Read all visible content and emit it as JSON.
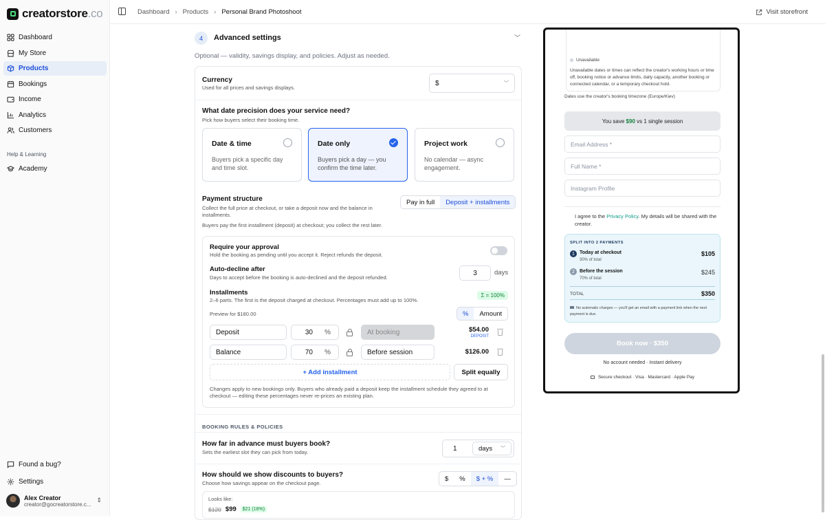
{
  "brand": {
    "name": "creatorstore",
    "suffix": ".co"
  },
  "nav": [
    {
      "label": "Dashboard",
      "icon": "grid-icon"
    },
    {
      "label": "My Store",
      "icon": "store-icon"
    },
    {
      "label": "Products",
      "icon": "box-icon",
      "active": true
    },
    {
      "label": "Bookings",
      "icon": "calendar-icon"
    },
    {
      "label": "Income",
      "icon": "wallet-icon"
    },
    {
      "label": "Analytics",
      "icon": "chart-icon"
    },
    {
      "label": "Customers",
      "icon": "users-icon"
    }
  ],
  "help_section": "Help & Learning",
  "academy": "Academy",
  "bug": "Found a bug?",
  "settings": "Settings",
  "user": {
    "name": "Alex Creator",
    "email": "creator@gocreatorstore.c..."
  },
  "breadcrumb": [
    "Dashboard",
    "Products",
    "Personal Brand Photoshoot"
  ],
  "visit": "Visit storefront",
  "step": {
    "num": "4",
    "title": "Advanced settings",
    "desc": "Optional — validity, savings display, and policies. Adjust as needed."
  },
  "currency": {
    "label": "Currency",
    "sub": "Used for all prices and savings displays.",
    "value": "$"
  },
  "precision": {
    "label": "What date precision does your service need?",
    "sub": "Pick how buyers select their booking time.",
    "options": [
      {
        "title": "Date & time",
        "desc": "Buyers pick a specific day and time slot."
      },
      {
        "title": "Date only",
        "desc": "Buyers pick a day — you confirm the time later.",
        "selected": true
      },
      {
        "title": "Project work",
        "desc": "No calendar — async engagement."
      }
    ]
  },
  "payment": {
    "label": "Payment structure",
    "sub": "Collect the full price at checkout, or take a deposit now and the balance in installments.",
    "note": "Buyers pay the first installment (deposit) at checkout; you collect the rest later.",
    "toggle": [
      "Pay in full",
      "Deposit + installments"
    ],
    "selected": "Deposit + installments"
  },
  "approval": {
    "label": "Require your approval",
    "sub": "Hold the booking as pending until you accept it. Reject refunds the deposit.",
    "enabled": false
  },
  "autodecline": {
    "label": "Auto-decline after",
    "sub": "Days to accept before the booking is auto-declined and the deposit refunded.",
    "value": "3",
    "unit": "days"
  },
  "installments": {
    "label": "Installments",
    "sub": "2–6 parts. The first is the deposit charged at checkout. Percentages must add up to 100%.",
    "badge": "Σ = 100%",
    "preview": "Preview for $180.00",
    "mode": [
      "%",
      "Amount"
    ],
    "rows": [
      {
        "name": "Deposit",
        "pct": "30",
        "sym": "%",
        "when": "At booking",
        "amount": "$54.00",
        "tag": "DEPOSIT"
      },
      {
        "name": "Balance",
        "pct": "70",
        "sym": "%",
        "when": "Before session",
        "amount": "$126.00",
        "tag": ""
      }
    ],
    "add": "+ Add installment",
    "split": "Split equally",
    "footnote": "Changes apply to new bookings only. Buyers who already paid a deposit keep the installment schedule they agreed to at checkout — editing these percentages never re-prices an existing plan."
  },
  "rules_heading": "BOOKING RULES & POLICIES",
  "advance": {
    "label": "How far in advance must buyers book?",
    "sub": "Sets the earliest slot they can pick from today.",
    "value": "1",
    "unit": "days"
  },
  "discounts": {
    "label": "How should we show discounts to buyers?",
    "sub": "Choose how savings appear on the checkout page.",
    "options": [
      "$",
      "%",
      "$ + %",
      "—"
    ],
    "selected": "$ + %",
    "looks": "Looks like:",
    "old": "$120",
    "new": "$99",
    "badge": "$21 (18%)"
  },
  "preview": {
    "unavailable": "Unavailable",
    "unavail_desc": "Unavailable dates or times can reflect the creator's working hours or time off, booking notice or advance limits, daily capacity, another booking or connected calendar, or a temporary checkout hold.",
    "tz": "Dates use the creator's booking timezone (Europe/Kiev)",
    "save_pre": "You save ",
    "save_amt": "$90",
    "save_post": " vs 1 single session",
    "fields": [
      "Email Address *",
      "Full Name *",
      "Instagram Profile"
    ],
    "agree_pre": "I agree to the ",
    "agree_link": "Privacy Policy",
    "agree_post": ". My details will be shared with the creator.",
    "split_title": "SPLIT INTO 2 PAYMENTS",
    "pay": [
      {
        "n": "1",
        "label": "Today at checkout",
        "pct": "30% of total",
        "amt": "$105"
      },
      {
        "n": "2",
        "label": "Before the session",
        "pct": "70% of total",
        "amt": "$245"
      }
    ],
    "total_label": "TOTAL",
    "total": "$350",
    "auto_note": "No automatic charges — you'll get an email with a payment link when the next payment is due.",
    "book": "Book now · $350",
    "no_account": "No account needed · Instant delivery",
    "secure": "Secure checkout · Visa · Mastercard · Apple Pay"
  },
  "colors": {
    "accent": "#2563eb",
    "success": "#15803d"
  }
}
